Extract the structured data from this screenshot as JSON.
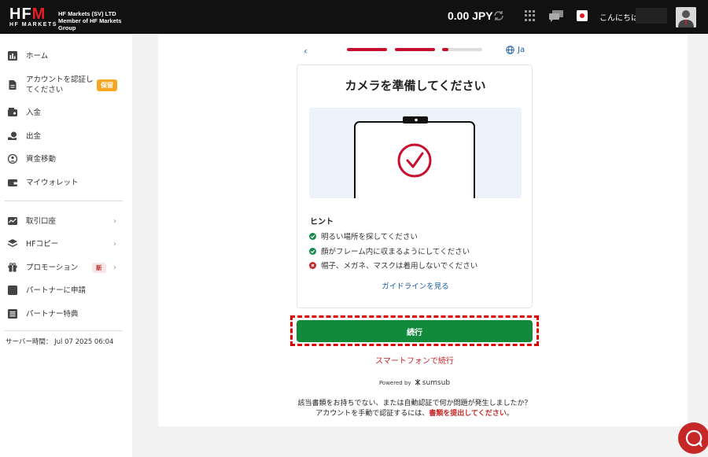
{
  "header": {
    "logo_text": "HF",
    "logo_m": "M",
    "logo_sub": "HF MARKETS",
    "company_line1": "HF Markets (SV) LTD",
    "company_line2": "Member of HF Markets Group",
    "balance": "0.00 JPY",
    "greeting": "こんにちは",
    "accent_color": "#e31e24"
  },
  "sidebar": {
    "items": [
      {
        "label": "ホーム",
        "icon": "chart-bar-icon"
      },
      {
        "label": "アカウントを認証してください",
        "label_line1": "アカウントを認証し",
        "label_line2": "てください",
        "badge": "保留",
        "icon": "document-icon"
      },
      {
        "label": "入金",
        "icon": "wallet-in-icon"
      },
      {
        "label": "出金",
        "icon": "hand-coin-icon"
      },
      {
        "label": "資金移動",
        "icon": "transfer-icon"
      },
      {
        "label": "マイウォレット",
        "icon": "wallet-icon"
      },
      {
        "label": "取引口座",
        "icon": "chart-line-icon"
      },
      {
        "label": "HFコピー",
        "icon": "layers-icon"
      },
      {
        "label": "プロモーション",
        "badge": "新",
        "icon": "gift-icon"
      },
      {
        "label": "パートナーに申請",
        "icon": "partner-icon"
      },
      {
        "label": "パートナー特典",
        "icon": "list-icon"
      }
    ],
    "server_time": "サーバー時間： Jul 07 2025 06:04"
  },
  "verification": {
    "language": "Ja",
    "progress": {
      "steps_complete": 2,
      "current_step_fill": 0.15,
      "total_steps": 3
    },
    "title": "カメラを準備してください",
    "hint_title": "ヒント",
    "hints": [
      {
        "text": "明るい場所を探してください",
        "status": "ok"
      },
      {
        "text": "顔がフレーム内に収まるようにしてください",
        "status": "ok"
      },
      {
        "text": "帽子、メガネ、マスクは着用しないでください",
        "status": "bad"
      }
    ],
    "guide_link": "ガイドラインを見る",
    "continue_label": "続行",
    "phone_link": "スマートフォンで続行",
    "powered_by": "Powered by",
    "brand": "sumsub",
    "footer_line1": "該当書類をお持ちでない、または自動認証で何か問題が発生しましたか？",
    "footer_line2_prefix": "アカウントを手動で認証するには、",
    "footer_line2_link": "書類を提出してください",
    "footer_line2_suffix": "。",
    "ok_color": "#1a8a4a",
    "bad_color": "#c62828",
    "button_color": "#118a3c"
  }
}
